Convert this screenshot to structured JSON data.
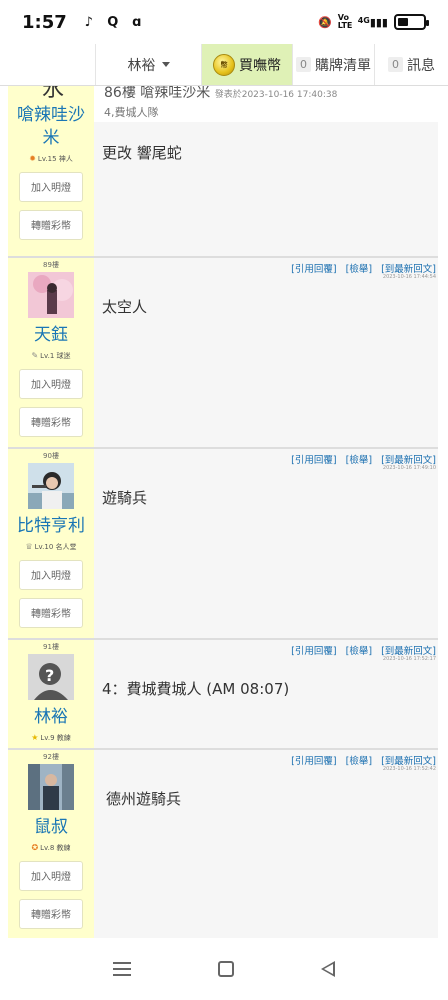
{
  "status": {
    "time": "1:57",
    "net": "4G",
    "volte": "Vo LTE"
  },
  "nav": {
    "user": "林裕",
    "buy": "買嘸幣",
    "cart_count": "0",
    "cart": "購牌清單",
    "msg_count": "0",
    "msg": "訊息"
  },
  "post0": {
    "author": "嗆辣哇沙米",
    "rank": "Lv.15 神人",
    "header": "86樓 嗆辣哇沙米",
    "header_small": "發表於2023-10-16 17:40:38",
    "sub": "4,費城人隊",
    "body": "更改 響尾蛇"
  },
  "buttons": {
    "light": "加入明燈",
    "gift": "轉贈彩幣"
  },
  "links": {
    "quote": "[引用回覆]",
    "report": "[檢舉]",
    "latest": "[到最新回文]"
  },
  "posts": [
    {
      "floor": "89樓",
      "name": "天鈺",
      "rank": "Lv.1 球迷",
      "time": "2023-10-16 17:44:54",
      "body": "太空人"
    },
    {
      "floor": "90樓",
      "name": "比特亨利",
      "rank": "Lv.10 名人堂",
      "time": "2023-10-16 17:49:10",
      "body": "遊騎兵"
    },
    {
      "floor": "91樓",
      "name": "林裕",
      "rank": "Lv.9 教練",
      "time": "2023-10-16 17:52:17",
      "body": "4：費城費城人 (AM 08:07)"
    },
    {
      "floor": "92樓",
      "name": "鼠叔",
      "rank": "Lv.8 教練",
      "time": "2023-10-16 17:52:42",
      "body": "德州遊騎兵"
    }
  ]
}
